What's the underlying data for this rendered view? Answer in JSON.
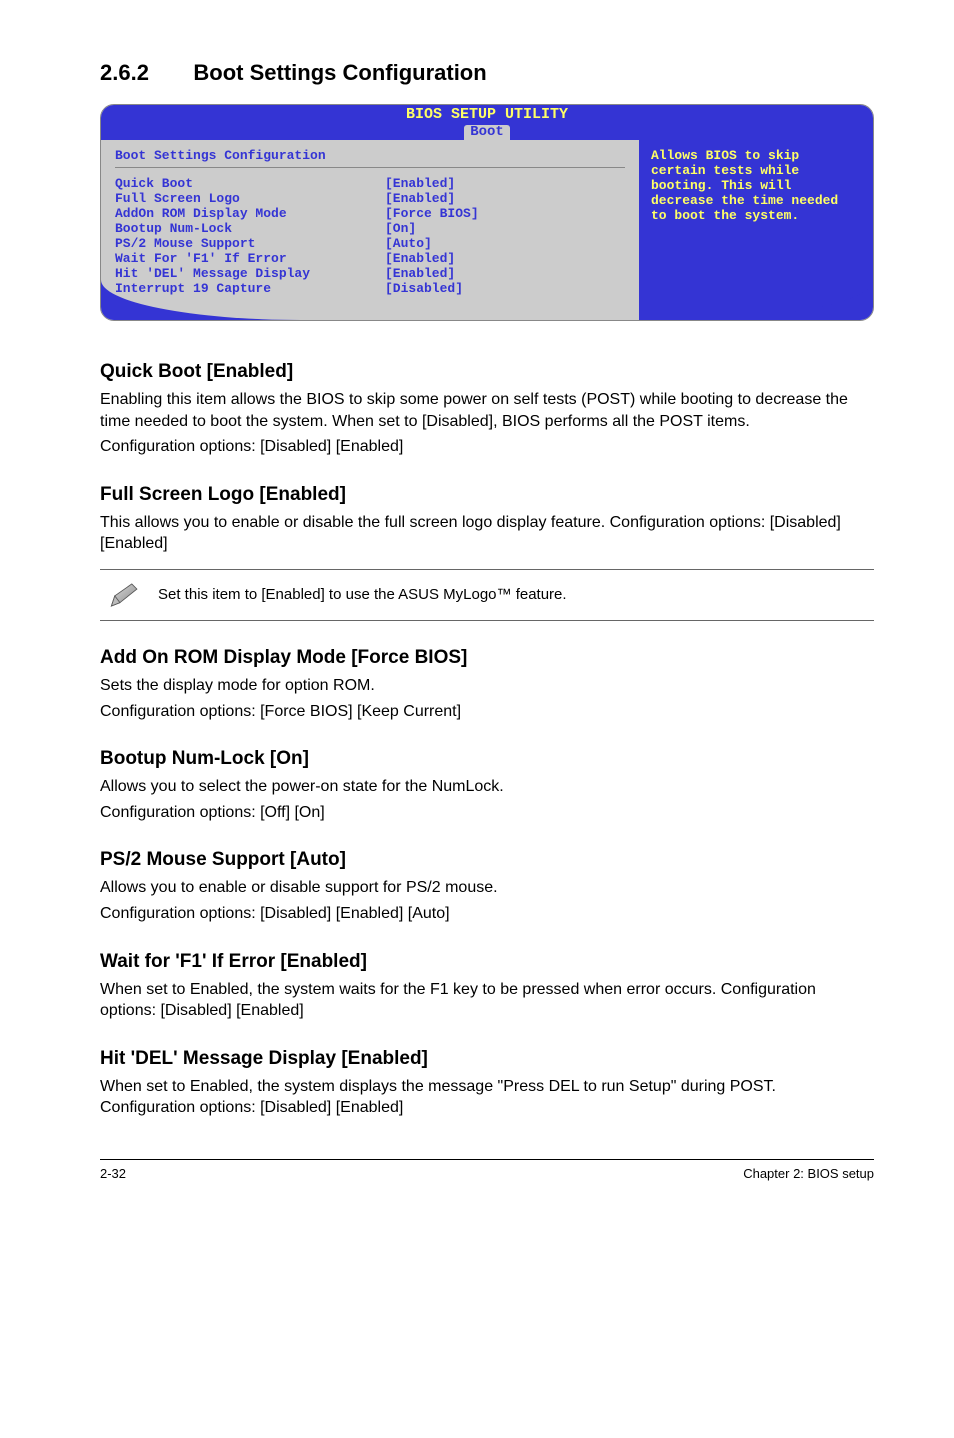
{
  "section": {
    "number": "2.6.2",
    "title": "Boot Settings Configuration"
  },
  "bios": {
    "window_title": "BIOS SETUP UTILITY",
    "tab": "Boot",
    "panel_title": "Boot Settings Configuration",
    "help_text": "Allows BIOS to skip certain tests while booting. This will decrease the time needed to boot the system.",
    "rows": [
      {
        "label": "Quick Boot",
        "value": "[Enabled]"
      },
      {
        "label": "Full Screen Logo",
        "value": "[Enabled]"
      },
      {
        "label": "AddOn ROM Display Mode",
        "value": "[Force BIOS]"
      },
      {
        "label": "Bootup Num-Lock",
        "value": "[On]"
      },
      {
        "label": "PS/2 Mouse Support",
        "value": "[Auto]"
      },
      {
        "label": "Wait For 'F1' If Error",
        "value": "[Enabled]"
      },
      {
        "label": "Hit 'DEL' Message Display",
        "value": "[Enabled]"
      },
      {
        "label": "Interrupt 19 Capture",
        "value": "[Disabled]"
      }
    ]
  },
  "quick_boot": {
    "heading": "Quick Boot [Enabled]",
    "p1": "Enabling this item allows the BIOS to skip some power on self tests (POST) while booting to decrease the time needed to boot the system. When set to [Disabled], BIOS performs all the POST items.",
    "p2": "Configuration options: [Disabled] [Enabled]"
  },
  "full_screen_logo": {
    "heading": "Full Screen Logo [Enabled]",
    "p1": "This allows you to enable or disable the full screen logo display feature. Configuration options: [Disabled] [Enabled]"
  },
  "note": {
    "text": "Set this item to [Enabled] to use the ASUS MyLogo™ feature."
  },
  "addon_rom": {
    "heading": "Add On ROM Display Mode [Force BIOS]",
    "p1": "Sets the display mode for option ROM.",
    "p2": "Configuration options: [Force BIOS] [Keep Current]"
  },
  "bootup_numlock": {
    "heading": "Bootup Num-Lock [On]",
    "p1": "Allows you to select the power-on state for the NumLock.",
    "p2": "Configuration options: [Off] [On]"
  },
  "ps2_mouse": {
    "heading": "PS/2 Mouse Support [Auto]",
    "p1": "Allows you to enable or disable support for PS/2 mouse.",
    "p2": "Configuration options: [Disabled] [Enabled] [Auto]"
  },
  "wait_f1": {
    "heading": "Wait for 'F1' If Error [Enabled]",
    "p1": "When set to Enabled, the system waits for the F1 key to be pressed when error occurs. Configuration options: [Disabled] [Enabled]"
  },
  "hit_del": {
    "heading": "Hit 'DEL' Message Display [Enabled]",
    "p1": "When set to Enabled, the system displays the message \"Press DEL to run Setup\" during POST. Configuration options: [Disabled] [Enabled]"
  },
  "footer": {
    "left": "2-32",
    "right": "Chapter 2: BIOS setup"
  }
}
